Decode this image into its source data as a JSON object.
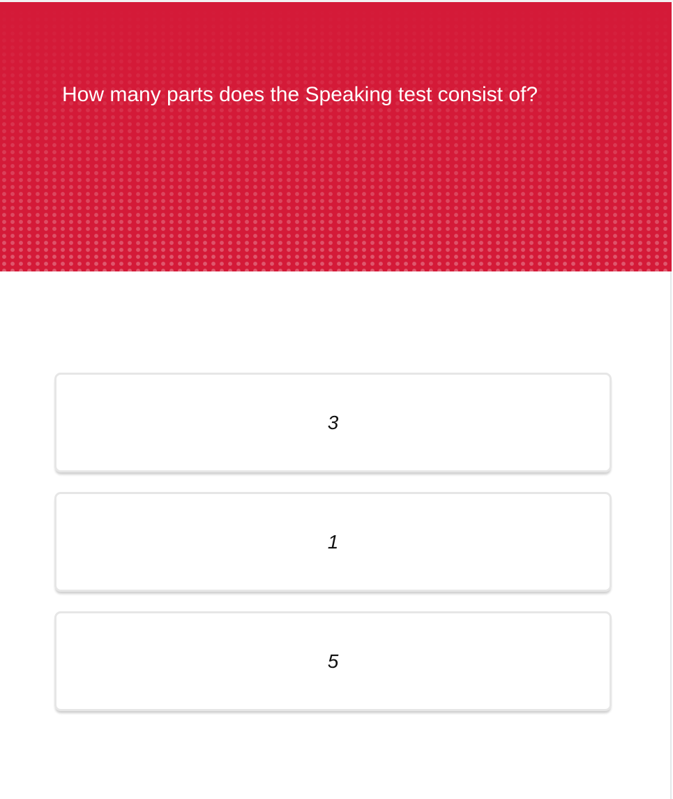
{
  "question": {
    "text": "How many parts does the Speaking test consist of?"
  },
  "answers": [
    {
      "label": "3"
    },
    {
      "label": "1"
    },
    {
      "label": "5"
    }
  ],
  "colors": {
    "header": "#d41a38",
    "card_border": "#e6e6e6"
  }
}
